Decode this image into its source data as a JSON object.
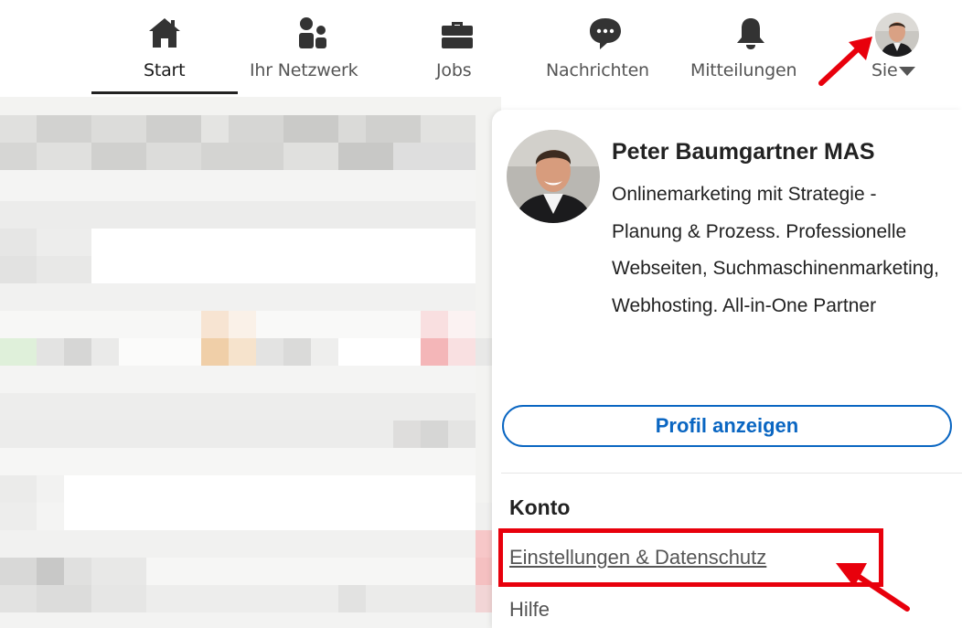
{
  "nav": {
    "items": [
      {
        "label": "Start",
        "icon": "home-icon",
        "active": true
      },
      {
        "label": "Ihr Netzwerk",
        "icon": "network-icon",
        "active": false
      },
      {
        "label": "Jobs",
        "icon": "briefcase-icon",
        "active": false
      },
      {
        "label": "Nachrichten",
        "icon": "messaging-icon",
        "active": false
      },
      {
        "label": "Mitteilungen",
        "icon": "bell-icon",
        "active": false
      }
    ],
    "me_label": "Sie"
  },
  "profile": {
    "name": "Peter Baumgartner MAS",
    "headline": "Onlinemarketing mit Strategie - Planung & Prozess. Professionelle Webseiten, Suchmaschinenmarketing, Webhosting. All-in-One Partner",
    "view_profile_label": "Profil anzeigen"
  },
  "account": {
    "title": "Konto",
    "settings_label": "Einstellungen & Datenschutz",
    "help_label": "Hilfe"
  },
  "colors": {
    "accent_blue": "#0a66c2",
    "annotation_red": "#e8000c",
    "icon_dark": "#333333"
  }
}
